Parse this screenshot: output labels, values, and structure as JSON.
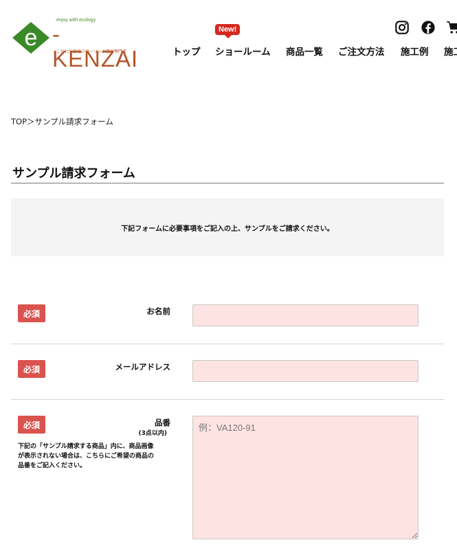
{
  "header": {
    "logo": {
      "tagline": "enjoy with ecology",
      "wordmark": "KENZAI",
      "subtitle": "こだわり無垢フローリング素材専門店"
    },
    "nav": [
      {
        "label": "トップ"
      },
      {
        "label": "ショールーム",
        "badge": "New!"
      },
      {
        "label": "商品一覧"
      },
      {
        "label": "ご注文方法"
      },
      {
        "label": "施工例"
      },
      {
        "label": "施工"
      }
    ],
    "icons": [
      "instagram-icon",
      "facebook-icon",
      "cart-icon"
    ]
  },
  "breadcrumb": {
    "home": "TOP",
    "separator": "＞",
    "current": "サンプル請求フォーム"
  },
  "page_title": "サンプル請求フォーム",
  "intro_text": "下記フォームに必要事項をご記入の上、サンプルをご請求ください。",
  "form": {
    "required_label": "必須",
    "fields": [
      {
        "label": "お名前",
        "value": "",
        "placeholder": ""
      },
      {
        "label": "メールアドレス",
        "value": "",
        "placeholder": ""
      },
      {
        "label": "品番",
        "sublabel": "(3点以内)",
        "note_lines": [
          "下記の「サンプル請求する商品」内に、商品画像",
          "が表示されない場合は、こちらにご希望の商品の",
          "品番をご記入ください。"
        ],
        "value": "",
        "placeholder": "例：VA120-91"
      }
    ]
  },
  "colors": {
    "brand_green": "#3b8a2a",
    "brand_brown": "#b5552a",
    "required_badge": "#d9534f",
    "input_bg": "#fde3e1",
    "new_badge": "#d4281e"
  }
}
